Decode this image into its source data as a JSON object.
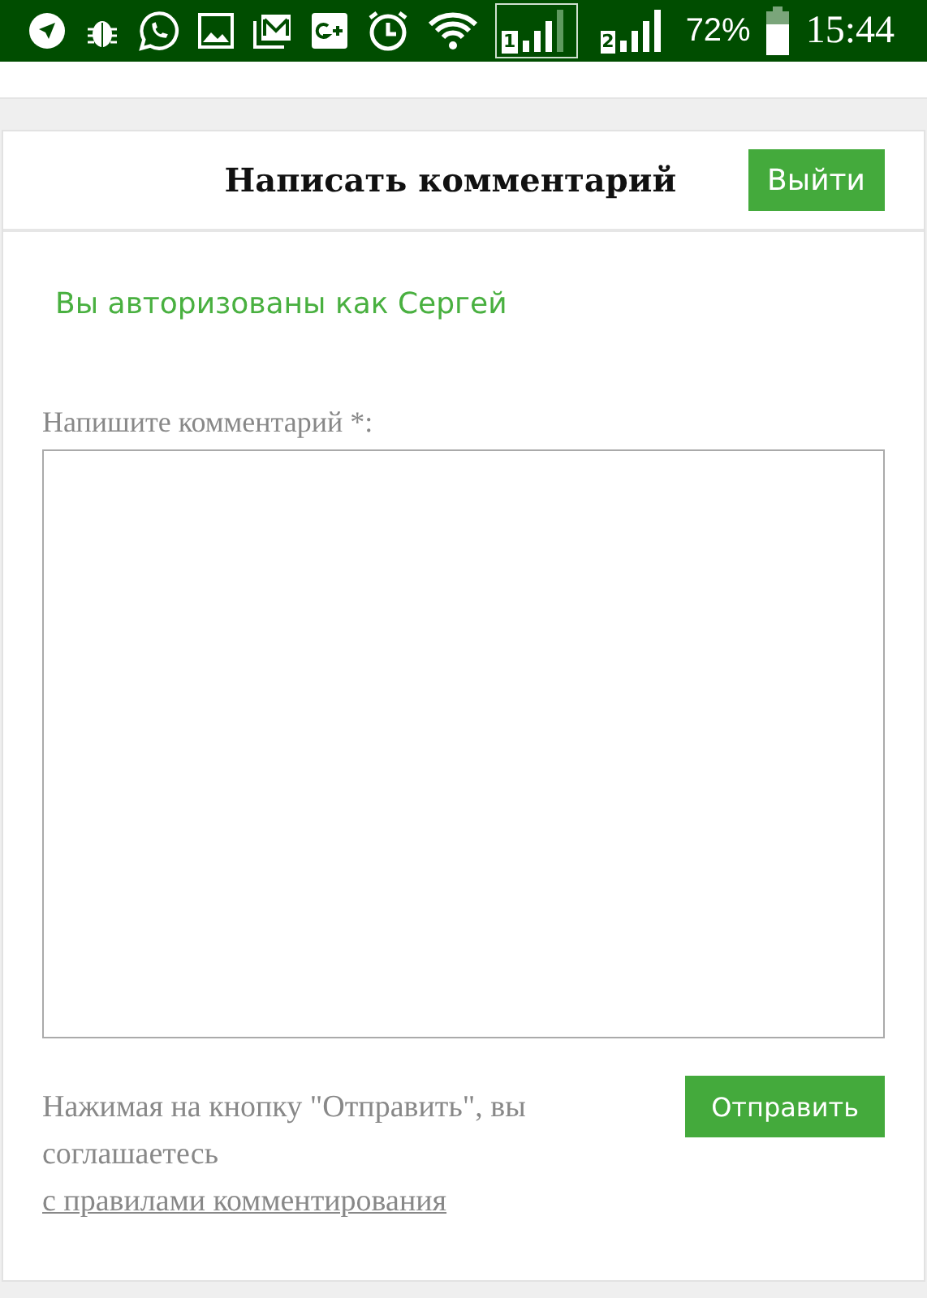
{
  "status_bar": {
    "sims": [
      {
        "label": "1",
        "selected": true
      },
      {
        "label": "2",
        "selected": false
      }
    ],
    "battery": "72%",
    "time": "15:44"
  },
  "comment_form": {
    "title": "Написать комментарий",
    "logout_button": "Выйти",
    "auth_note": "Вы авторизованы как Сергей",
    "field_label": "Напишите комментарий *:",
    "consent_text": "Нажимая на кнопку \"Отправить\", вы соглашаетесь",
    "consent_link": "с правилами комментирования",
    "submit_button": "Отправить"
  }
}
